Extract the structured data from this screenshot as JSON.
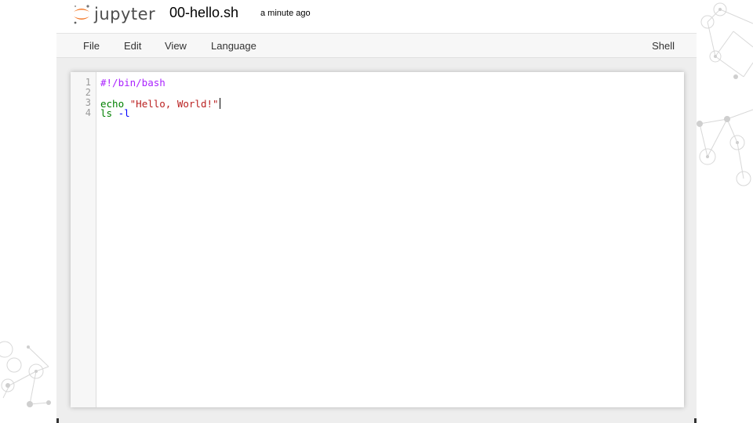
{
  "header": {
    "logo_text": "jupyter",
    "file_name": "00-hello.sh",
    "save_status": "a minute ago"
  },
  "menubar": {
    "items": [
      "File",
      "Edit",
      "View",
      "Language"
    ],
    "mode": "Shell"
  },
  "editor": {
    "line_numbers": [
      "1",
      "2",
      "3",
      "4"
    ],
    "lines": {
      "l1_meta": "#!/bin/bash",
      "l3_builtin": "echo",
      "l3_space": " ",
      "l3_string": "\"Hello, World!\"",
      "l4_builtin": "ls",
      "l4_space": " ",
      "l4_arg": "-l"
    }
  },
  "colors": {
    "logo_orange": "#f37726",
    "meta": "#aa22ff",
    "builtin": "#008000",
    "string": "#ba2121",
    "keyword": "#0000ff"
  }
}
